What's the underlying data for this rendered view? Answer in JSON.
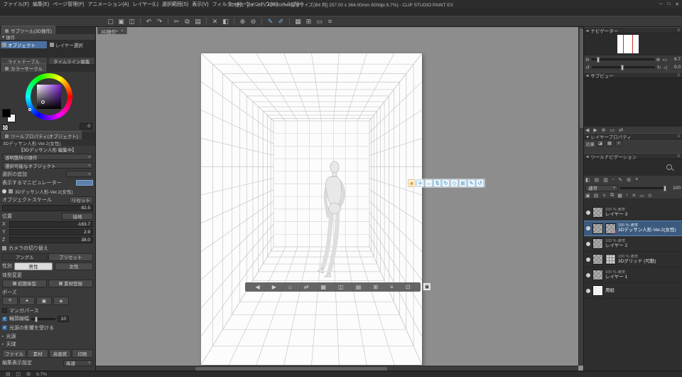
{
  "chrome": {
    "collapse": "◂",
    "menu": "≡",
    "down": "▾",
    "dropdown": "▾"
  },
  "menubar": {
    "menus": [
      "ファイル(F)",
      "編集(E)",
      "ページ管理(P)",
      "アニメーション(A)",
      "レイヤー(L)",
      "選択範囲(S)",
      "表示(V)",
      "フィルター(I)",
      "ウィンドウ(W)",
      "ヘルプ(H)"
    ],
    "title": "3D操作* [297.00 x 420.00mm 製本サイズ(B4 判] 257.00 x 364.00mm 600dpi 6.7%) - CLIP STUDIO PAINT EX",
    "minimize": "─",
    "maximize": "□",
    "close": "✕"
  },
  "toolbar": {
    "icons": [
      "▢",
      "▣",
      "◫",
      "↶",
      "↷",
      "✂",
      "⧉",
      "▤",
      "✕",
      "◧",
      "⊕",
      "⊖",
      "✎",
      "✐",
      "▦",
      "⊞",
      "▭",
      "≡"
    ]
  },
  "subtool": {
    "tab": "サブツール(3D操作)",
    "group": "操作",
    "item_object": "オブジェクト",
    "item_layer_select": "レイヤー選択",
    "palette_light_table": "ライトテーブル",
    "palette_timeline": "タイムライン編集"
  },
  "color": {
    "tab": "カラーサークル",
    "value": "0"
  },
  "tool_property": {
    "tab": "ツールプロパティ(オブジェクト)",
    "subtitle": "3Dデッサン人形-Ver.2(女性)",
    "editing": "【3Dデッサン人形 編集中】",
    "transparent": "透明箇所の操作",
    "selectable": "選択可能なオブジェクト",
    "selection_add": "選択の追加",
    "manipulator": "表示するマニピュレーター",
    "object_name": "3Dデッサン人形-Ver.2(女性)",
    "scale_label": "オブジェクトスケール",
    "reset": "リセット",
    "scale_value": "82.5",
    "position": "位置",
    "ground": "接地",
    "x_label": "X",
    "x_value": "-183.7",
    "y_label": "Y",
    "y_value": "2.9",
    "z_label": "Z",
    "z_value": "38.0",
    "camera": "カメラの切り替え",
    "angle": "アングル",
    "preset": "プリセット",
    "gender": "性別",
    "male": "男性",
    "female": "女性",
    "body_change": "体型変更",
    "init_body": "初期体型",
    "register": "素材登録",
    "pose": "ポーズ",
    "pose_icons": [
      "≡",
      "✦",
      "▣",
      "◈"
    ],
    "manga": "マンガパース",
    "outline": "輪郭線幅",
    "outline_value": "10",
    "light_affect": "光源の影響を受ける",
    "light_source": "光源",
    "sky": "天球",
    "tab_file": "ファイル",
    "tab_material": "素材",
    "tab_quality": "高画質",
    "tab_print": "印刷",
    "display_label": "編集表示設定",
    "display_value": "高速"
  },
  "canvas": {
    "tab_label": "3D操作*",
    "tab_close": "✕",
    "manipulator_icons": [
      "◉",
      "＋",
      "↔",
      "⇅",
      "↻",
      "◇",
      "⊞",
      "✎",
      "↺"
    ],
    "launcher_icons": [
      "◀",
      "▶",
      "⌂",
      "⇄",
      "▦",
      "◫",
      "▤",
      "⊞",
      "≡",
      "⊡"
    ],
    "launcher_end_icon": "▣"
  },
  "navigator": {
    "tab": "ナビゲーター",
    "zoom_out": "⊖",
    "zoom_in": "⊕",
    "fit": "▭",
    "zoom_value": "6.7",
    "rotate_ccw": "↺",
    "rotate_cw": "↻",
    "reset": "◁",
    "rotate_value": "0.0"
  },
  "subview": {
    "tab": "サブビュー",
    "icons": [
      "◀",
      "▶",
      "⊕",
      "▭",
      "⇄"
    ]
  },
  "layer_property": {
    "tab": "レイヤープロパティ",
    "effect": "効果",
    "effect_icons": [
      "◪",
      "▦",
      "✧"
    ]
  },
  "tool_navigation": {
    "tab": "ツールナビゲーション"
  },
  "layers": {
    "icons_top": [
      "◧",
      "▤",
      "▥",
      "▫",
      "✎",
      "⊞",
      "≡"
    ],
    "blend": "通常",
    "opacity_value": "100",
    "icons_commands": [
      "▣",
      "▤",
      "＋",
      "⧉",
      "▦",
      "↑",
      "✕",
      "▭",
      "⊙"
    ],
    "rows": [
      {
        "info": "100 % 通常",
        "name": "レイヤー 3"
      },
      {
        "info": "100 % 通常",
        "name": "3Dデッサン人形-Ver.2(女性)",
        "badge": "✕"
      },
      {
        "info": "100 % 通常",
        "name": "レイヤー 2"
      },
      {
        "info": "100 % 通常",
        "name": "3Dグリッド (可動)"
      },
      {
        "info": "100 % 通常",
        "name": "レイヤー 1"
      },
      {
        "name": "用紙"
      }
    ]
  },
  "statusbar": {
    "icons": [
      "▤",
      "◫",
      "⊞"
    ],
    "zoom": "6.7%"
  }
}
